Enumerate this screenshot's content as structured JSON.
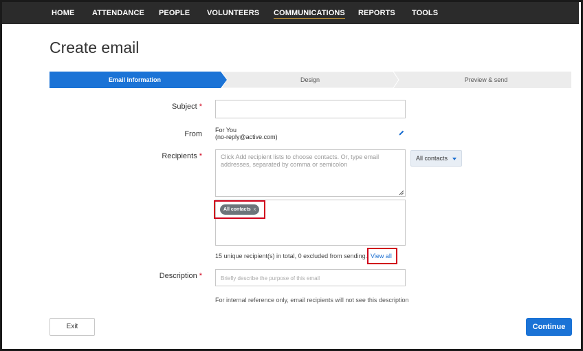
{
  "nav": {
    "items": [
      {
        "label": "HOME"
      },
      {
        "label": "ATTENDANCE"
      },
      {
        "label": "PEOPLE"
      },
      {
        "label": "VOLUNTEERS"
      },
      {
        "label": "COMMUNICATIONS",
        "active": true
      },
      {
        "label": "REPORTS"
      },
      {
        "label": "TOOLS"
      }
    ]
  },
  "page": {
    "title": "Create email"
  },
  "stepper": {
    "steps": [
      {
        "label": "Email information",
        "active": true
      },
      {
        "label": "Design"
      },
      {
        "label": "Preview & send"
      }
    ],
    "active_color": "#1b73d6",
    "inactive_color": "#ececec"
  },
  "form": {
    "required_mark": "*",
    "subject": {
      "label": "Subject",
      "value": ""
    },
    "from": {
      "label": "From",
      "name": "For You",
      "email": "(no-reply@active.com)"
    },
    "recipients": {
      "label": "Recipients",
      "placeholder": "Click Add recipient lists to choose contacts. Or, type email addresses, separated by comma or semicolon",
      "dropdown_value": "All contacts",
      "chips": [
        {
          "label": "All contacts",
          "remove": "x"
        }
      ],
      "summary": "15 unique recipient(s) in total, 0 excluded from sending.",
      "view_all": "View all"
    },
    "description": {
      "label": "Description",
      "placeholder": "Briefly describe the purpose of this email",
      "help": "For internal reference only, email recipients will not see this description"
    }
  },
  "footer": {
    "exit_label": "Exit",
    "continue_label": "Continue"
  },
  "colors": {
    "highlight": "#d0021b",
    "link": "#1b6fd1",
    "primary": "#1b73d6"
  }
}
